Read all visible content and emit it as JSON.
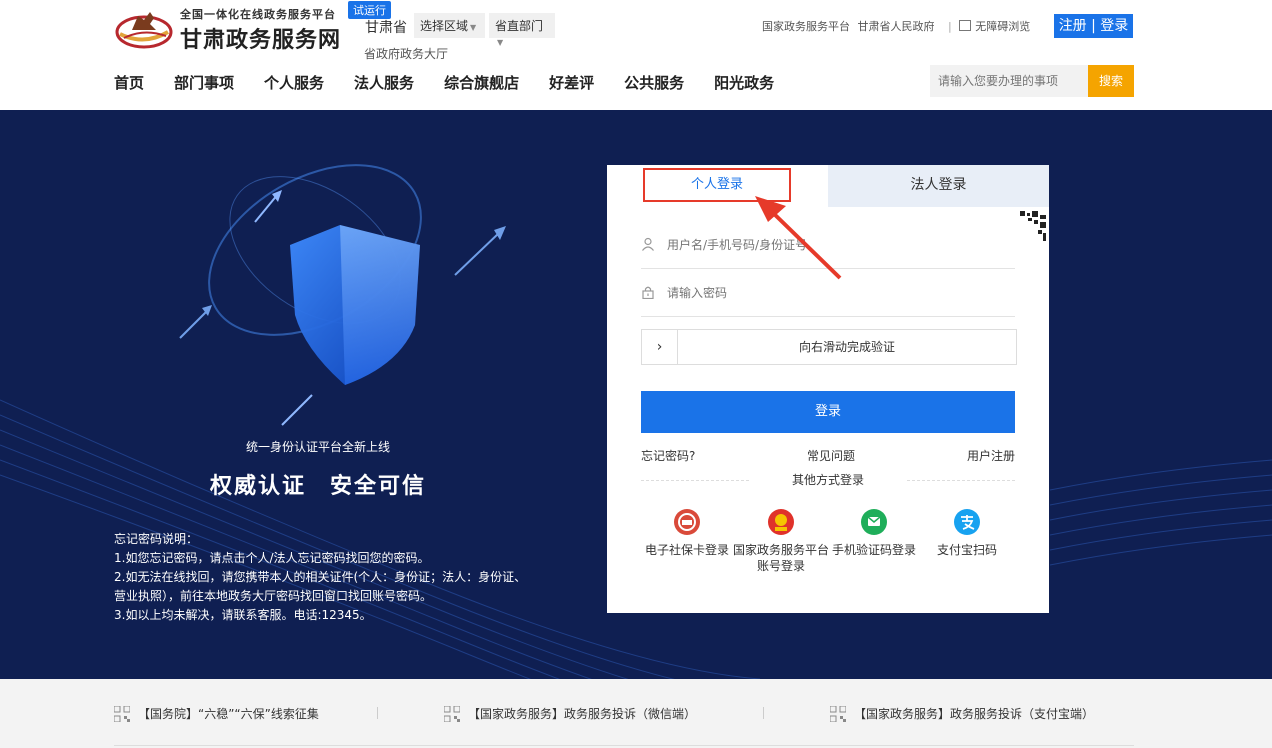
{
  "header": {
    "logo_sub": "全国一体化在线政务服务平台",
    "logo_main": "甘肃政务服务网",
    "trial_badge": "试运行",
    "province": "甘肃省",
    "region_select": "选择区域",
    "dept_select": "省直部门",
    "hall_link": "省政府政务大厅",
    "top_links": [
      "国家政务服务平台",
      "甘肃省人民政府"
    ],
    "accessibility": "无障碍浏览",
    "auth": "注册 | 登录",
    "nav": [
      "首页",
      "部门事项",
      "个人服务",
      "法人服务",
      "综合旗舰店",
      "好差评",
      "公共服务",
      "阳光政务"
    ],
    "search_placeholder": "请输入您要办理的事项",
    "search_button": "搜索"
  },
  "hero": {
    "tagline": "统一身份认证平台全新上线",
    "slogan": "权威认证　安全可信",
    "notes": [
      "忘记密码说明：",
      "1.如您忘记密码，请点击个人/法人忘记密码找回您的密码。",
      "2.如无法在线找回，请您携带本人的相关证件(个人：身份证；法人：身份证、",
      "营业执照），前往本地政务大厅密码找回窗口找回账号密码。",
      "3.如以上均未解决，请联系客服。电话:12345。"
    ]
  },
  "login": {
    "tab_personal": "个人登录",
    "tab_legal": "法人登录",
    "username_placeholder": "用户名/手机号码/身份证号",
    "password_placeholder": "请输入密码",
    "slider_handle": "›",
    "slider_text": "向右滑动完成验证",
    "login_button": "登录",
    "forgot": "忘记密码?",
    "faq": "常见问题",
    "register": "用户注册",
    "other_title": "其他方式登录",
    "methods": [
      {
        "label": "电子社保卡登录",
        "icon": "social-security-card-icon",
        "color": "#d94a3a"
      },
      {
        "label": "国家政务服务平台账号登录",
        "icon": "national-emblem-icon",
        "color": "#e0322a"
      },
      {
        "label": "手机验证码登录",
        "icon": "sms-icon",
        "color": "#1fae5a"
      },
      {
        "label": "支付宝扫码",
        "icon": "alipay-icon",
        "color": "#17a2f0"
      }
    ]
  },
  "footer": {
    "notices": [
      "【国务院】“六稳”“六保”线索征集",
      "【国家政务服务】政务服务投诉（微信端）",
      "【国家政务服务】政务服务投诉（支付宝端）"
    ]
  },
  "colors": {
    "primary": "#1a73e8",
    "hero_bg": "#0f1f52",
    "search_button": "#f5a400",
    "highlight": "#e63a2a"
  }
}
